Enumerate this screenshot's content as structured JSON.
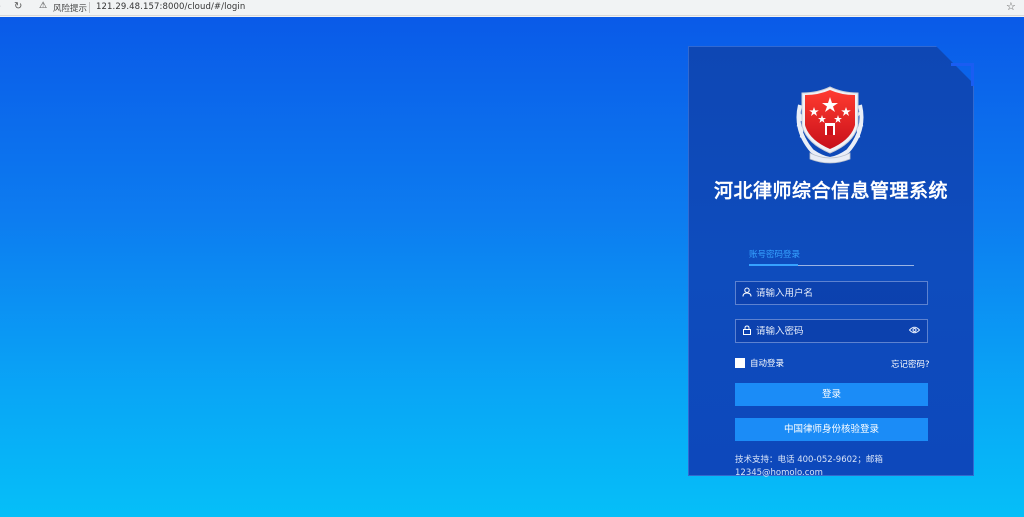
{
  "browser": {
    "warning_text": "风险提示",
    "url": "121.29.48.157:8000/cloud/#/login"
  },
  "icons": {
    "back": "back-arrow-icon",
    "reload": "reload-icon",
    "warning": "warning-triangle-icon",
    "bookmark": "star-icon",
    "user": "user-icon",
    "lock": "lock-icon",
    "eye": "eye-icon",
    "emblem": "lawyer-emblem-icon"
  },
  "colors": {
    "accent": "#1b8cf7",
    "tab_active": "#36a2ff",
    "card": "#0e47b4"
  },
  "login": {
    "title": "河北律师综合信息管理系统",
    "tab_label": "账号密码登录",
    "username_placeholder": "请输入用户名",
    "password_placeholder": "请输入密码",
    "remember_label": "自动登录",
    "forgot_label": "忘记密码?",
    "login_button": "登录",
    "cert_button": "中国律师身份核验登录",
    "support_text": "技术支持：电话 400-052-9602；邮箱 12345@homolo.com"
  }
}
